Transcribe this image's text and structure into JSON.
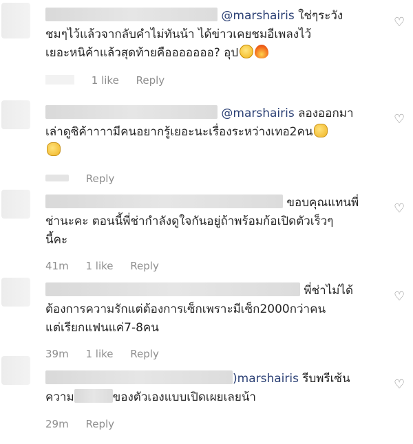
{
  "comments": [
    {
      "mention": "@marshairis",
      "line1": " ใช่ๆระวัง",
      "line2": "ชมๆไว้แล้วจากลับคำไม่ทันน้า ได้ข่าวเคยชมอีเพลงไว้",
      "line3": "เยอะหนิค้าแล้วสุดท้ายคือออออออ? อุป",
      "likes": "1 like",
      "reply": "Reply"
    },
    {
      "mention": "@marshairis",
      "line1": " ลองออกมา",
      "line2": "เล่าดูซิค้าาาามีคนอยากรู้เยอะนะเรื่องระหว่างเทอ2คน",
      "reply": "Reply"
    },
    {
      "line1": "ขอบคุณแทนพี่",
      "line2": "ช่านะคะ ตอนนี้พี่ช่ากำลังดูใจกันอยู่ถ้าพร้อมก้อเปิดตัวเร็วๆ",
      "line3": "นี้คะ",
      "time": "41m",
      "likes": "1 like",
      "reply": "Reply"
    },
    {
      "line1": "พี่ช่าไม่ได้",
      "line2": "ต้องการความรักแต่ต้องการเซ็กเพราะมีเซ็ก2000กว่าคน",
      "line3": "แต่เรียกแฟนแค่7-8คน",
      "time": "39m",
      "likes": "1 like",
      "reply": "Reply"
    },
    {
      "mention": ")marshairis",
      "line1": " รีบพรีเซ้น",
      "line2a": "ความ",
      "line2b": "ของตัวเองแบบเปิดเผยเลยน้า",
      "time": "29m",
      "reply": "Reply"
    }
  ]
}
